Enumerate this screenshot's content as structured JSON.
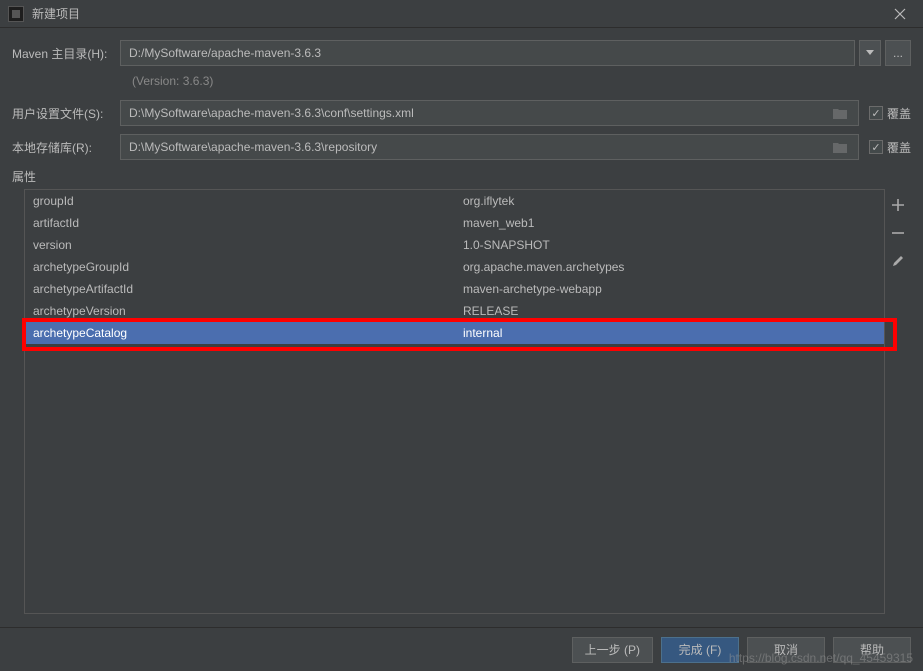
{
  "titlebar": {
    "title": "新建项目"
  },
  "form": {
    "home_label": "Maven 主目录(H):",
    "home_value": "D:/MySoftware/apache-maven-3.6.3",
    "version_text": "(Version: 3.6.3)",
    "settings_label": "用户设置文件(S):",
    "settings_value": "D:\\MySoftware\\apache-maven-3.6.3\\conf\\settings.xml",
    "repo_label": "本地存储库(R):",
    "repo_value": "D:\\MySoftware\\apache-maven-3.6.3\\repository",
    "override_label": "覆盖"
  },
  "props": {
    "section_label": "属性",
    "rows": [
      {
        "key": "groupId",
        "value": "org.iflytek"
      },
      {
        "key": "artifactId",
        "value": "maven_web1"
      },
      {
        "key": "version",
        "value": "1.0-SNAPSHOT"
      },
      {
        "key": "archetypeGroupId",
        "value": "org.apache.maven.archetypes"
      },
      {
        "key": "archetypeArtifactId",
        "value": "maven-archetype-webapp"
      },
      {
        "key": "archetypeVersion",
        "value": "RELEASE"
      },
      {
        "key": "archetypeCatalog",
        "value": "internal"
      }
    ]
  },
  "footer": {
    "prev": "上一步 (P)",
    "finish": "完成 (F)",
    "cancel": "取消",
    "help": "帮助"
  },
  "watermark": "https://blog.csdn.net/qq_45459315"
}
